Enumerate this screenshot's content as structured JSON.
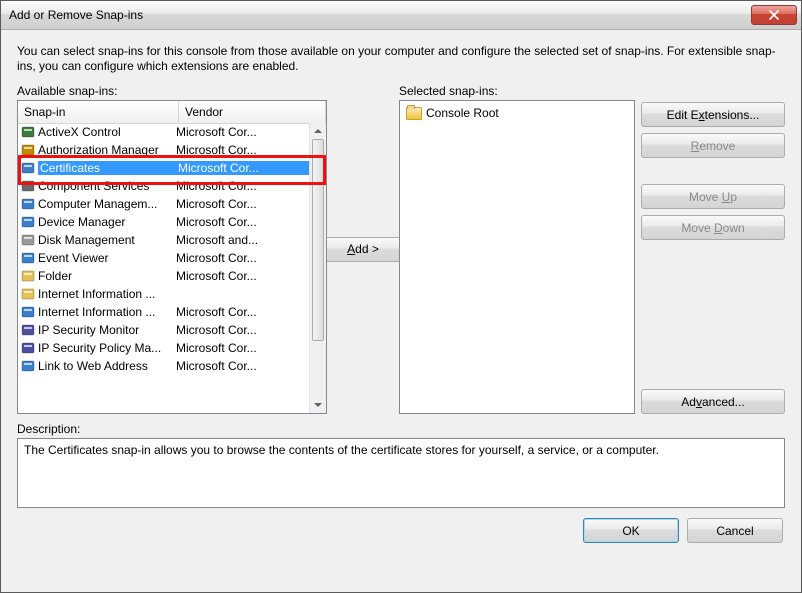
{
  "window": {
    "title": "Add or Remove Snap-ins"
  },
  "intro": "You can select snap-ins for this console from those available on your computer and configure the selected set of snap-ins. For extensible snap-ins, you can configure which extensions are enabled.",
  "labels": {
    "available": "Available snap-ins:",
    "selected": "Selected snap-ins:",
    "description": "Description:"
  },
  "headers": {
    "snapin": "Snap-in",
    "vendor": "Vendor"
  },
  "snapins": [
    {
      "name": "ActiveX Control",
      "vendor": "Microsoft Cor...",
      "icon": "activex"
    },
    {
      "name": "Authorization Manager",
      "vendor": "Microsoft Cor...",
      "icon": "authz"
    },
    {
      "name": "Certificates",
      "vendor": "Microsoft Cor...",
      "icon": "cert",
      "selected": true,
      "highlighted": true
    },
    {
      "name": "Component Services",
      "vendor": "Microsoft Cor...",
      "icon": "comp"
    },
    {
      "name": "Computer Managem...",
      "vendor": "Microsoft Cor...",
      "icon": "mgmt"
    },
    {
      "name": "Device Manager",
      "vendor": "Microsoft Cor...",
      "icon": "device"
    },
    {
      "name": "Disk Management",
      "vendor": "Microsoft and...",
      "icon": "disk"
    },
    {
      "name": "Event Viewer",
      "vendor": "Microsoft Cor...",
      "icon": "event"
    },
    {
      "name": "Folder",
      "vendor": "Microsoft Cor...",
      "icon": "folder"
    },
    {
      "name": "Internet Information ...",
      "vendor": "",
      "icon": "folder"
    },
    {
      "name": "Internet Information ...",
      "vendor": "Microsoft Cor...",
      "icon": "iis"
    },
    {
      "name": "IP Security Monitor",
      "vendor": "Microsoft Cor...",
      "icon": "ipmon"
    },
    {
      "name": "IP Security Policy Ma...",
      "vendor": "Microsoft Cor...",
      "icon": "ippol"
    },
    {
      "name": "Link to Web Address",
      "vendor": "Microsoft Cor...",
      "icon": "link"
    }
  ],
  "selected_items": [
    {
      "label": "Console Root"
    }
  ],
  "buttons": {
    "add": "Add >",
    "edit_ext": "Edit Extensions...",
    "remove": "Remove",
    "move_up": "Move Up",
    "move_down": "Move Down",
    "advanced": "Advanced...",
    "ok": "OK",
    "cancel": "Cancel"
  },
  "description_text": "The Certificates snap-in allows you to browse the contents of the certificate stores for yourself, a service, or a computer.",
  "icons": {
    "activex": "#3b7a3b",
    "authz": "#c48a00",
    "cert": "#3a7ecf",
    "comp": "#6b6b6b",
    "mgmt": "#3a7ecf",
    "device": "#3a7ecf",
    "disk": "#9a9a9a",
    "event": "#3a7ecf",
    "folder": "#e8c252",
    "iis": "#3a7ecf",
    "ipmon": "#4f4fa0",
    "ippol": "#4f4fa0",
    "link": "#3a7ecf"
  }
}
